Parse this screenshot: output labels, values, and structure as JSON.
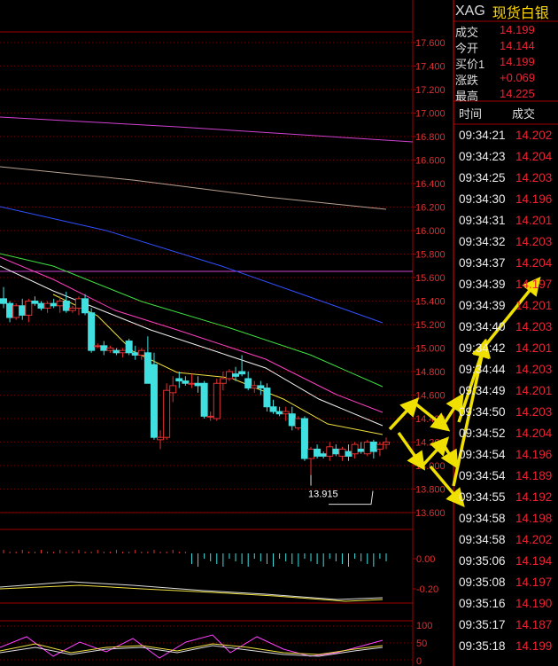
{
  "header": {
    "code": "XAG",
    "name": "现货白银"
  },
  "quote": [
    {
      "label": "成交",
      "value": "14.199"
    },
    {
      "label": "今开",
      "value": "14.144"
    },
    {
      "label": "买价1",
      "value": "14.199"
    },
    {
      "label": "涨跌",
      "value": "+0.069"
    },
    {
      "label": "最高",
      "value": "14.225"
    }
  ],
  "ticks_header": {
    "time": "时间",
    "price": "成交"
  },
  "ticks": [
    {
      "time": "09:34:21",
      "price": "14.202"
    },
    {
      "time": "09:34:23",
      "price": "14.204"
    },
    {
      "time": "09:34:25",
      "price": "14.203"
    },
    {
      "time": "09:34:30",
      "price": "14.196"
    },
    {
      "time": "09:34:31",
      "price": "14.201"
    },
    {
      "time": "09:34:32",
      "price": "14.203"
    },
    {
      "time": "09:34:37",
      "price": "14.204"
    },
    {
      "time": "09:34:39",
      "price": "14.197"
    },
    {
      "time": "09:34:39",
      "price": "14.201"
    },
    {
      "time": "09:34:40",
      "price": "14.203"
    },
    {
      "time": "09:34:42",
      "price": "14.201"
    },
    {
      "time": "09:34:44",
      "price": "14.203"
    },
    {
      "time": "09:34:49",
      "price": "14.201"
    },
    {
      "time": "09:34:50",
      "price": "14.203"
    },
    {
      "time": "09:34:52",
      "price": "14.204"
    },
    {
      "time": "09:34:54",
      "price": "14.196"
    },
    {
      "time": "09:34:54",
      "price": "14.189"
    },
    {
      "time": "09:34:55",
      "price": "14.192"
    },
    {
      "time": "09:34:58",
      "price": "14.198"
    },
    {
      "time": "09:34:58",
      "price": "14.202"
    },
    {
      "time": "09:35:06",
      "price": "14.194"
    },
    {
      "time": "09:35:08",
      "price": "14.197"
    },
    {
      "time": "09:35:16",
      "price": "14.190"
    },
    {
      "time": "09:35:17",
      "price": "14.187"
    },
    {
      "time": "09:35:18",
      "price": "14.199"
    }
  ],
  "colors": {
    "up": "#e23030",
    "down": "#40e0e0",
    "grid": "#7a0000",
    "axis_text": "#e23030",
    "arrow": "#f0e000"
  },
  "chart_data": [
    {
      "type": "candlestick",
      "title": "",
      "ylim": [
        13.6,
        17.7
      ],
      "y_ticks": [
        "17.600",
        "17.400",
        "17.200",
        "17.000",
        "16.800",
        "16.600",
        "16.400",
        "16.200",
        "16.000",
        "15.800",
        "15.600",
        "15.400",
        "15.200",
        "15.000",
        "14.800",
        "14.600",
        "14.400",
        "14.200",
        "14.000",
        "13.800",
        "13.600"
      ],
      "low_label": "13.915",
      "candles": [
        [
          15.42,
          15.52,
          15.34,
          15.38
        ],
        [
          15.38,
          15.4,
          15.22,
          15.26
        ],
        [
          15.26,
          15.38,
          15.24,
          15.36
        ],
        [
          15.36,
          15.42,
          15.24,
          15.28
        ],
        [
          15.28,
          15.42,
          15.22,
          15.4
        ],
        [
          15.4,
          15.44,
          15.36,
          15.38
        ],
        [
          15.38,
          15.4,
          15.32,
          15.34
        ],
        [
          15.34,
          15.4,
          15.3,
          15.38
        ],
        [
          15.38,
          15.42,
          15.34,
          15.36
        ],
        [
          15.36,
          15.44,
          15.3,
          15.4
        ],
        [
          15.4,
          15.48,
          15.3,
          15.32
        ],
        [
          15.32,
          15.36,
          15.3,
          15.34
        ],
        [
          15.34,
          15.44,
          15.28,
          15.42
        ],
        [
          15.42,
          15.46,
          15.28,
          15.3
        ],
        [
          15.3,
          15.34,
          14.96,
          14.98
        ],
        [
          15.02,
          15.04,
          15.0,
          15.02
        ],
        [
          15.02,
          15.06,
          14.94,
          14.98
        ],
        [
          14.98,
          15.02,
          14.96,
          15.0
        ],
        [
          14.98,
          15.0,
          14.94,
          14.96
        ],
        [
          14.96,
          15.0,
          14.92,
          14.98
        ],
        [
          15.06,
          15.08,
          14.94,
          14.96
        ],
        [
          14.96,
          15.02,
          14.9,
          14.94
        ],
        [
          14.94,
          15.0,
          14.9,
          14.98
        ],
        [
          14.96,
          15.1,
          14.74,
          14.7
        ],
        [
          14.86,
          14.96,
          14.22,
          14.24
        ],
        [
          14.22,
          14.3,
          14.14,
          14.24
        ],
        [
          14.24,
          14.7,
          14.22,
          14.64
        ],
        [
          14.62,
          14.76,
          14.54,
          14.68
        ],
        [
          14.74,
          14.8,
          14.66,
          14.72
        ],
        [
          14.72,
          14.76,
          14.68,
          14.7
        ],
        [
          14.7,
          14.78,
          14.66,
          14.7
        ],
        [
          14.7,
          14.76,
          14.62,
          14.68
        ],
        [
          14.7,
          14.72,
          14.4,
          14.42
        ],
        [
          14.42,
          14.46,
          14.38,
          14.42
        ],
        [
          14.4,
          14.74,
          14.38,
          14.7
        ],
        [
          14.7,
          14.8,
          14.64,
          14.74
        ],
        [
          14.74,
          14.82,
          14.72,
          14.8
        ],
        [
          14.78,
          14.84,
          14.72,
          14.76
        ],
        [
          14.8,
          14.94,
          14.76,
          14.78
        ],
        [
          14.74,
          14.8,
          14.64,
          14.66
        ],
        [
          14.66,
          14.72,
          14.62,
          14.68
        ],
        [
          14.68,
          14.72,
          14.6,
          14.66
        ],
        [
          14.66,
          14.7,
          14.46,
          14.5
        ],
        [
          14.5,
          14.56,
          14.44,
          14.46
        ],
        [
          14.46,
          14.5,
          14.42,
          14.44
        ],
        [
          14.44,
          14.5,
          14.38,
          14.46
        ],
        [
          14.44,
          14.5,
          14.3,
          14.34
        ],
        [
          14.32,
          14.42,
          14.3,
          14.4
        ],
        [
          14.4,
          14.42,
          14.04,
          14.06
        ],
        [
          14.06,
          14.16,
          13.92,
          14.14
        ],
        [
          14.14,
          14.18,
          14.06,
          14.08
        ],
        [
          14.1,
          14.12,
          14.06,
          14.08
        ],
        [
          14.08,
          14.2,
          14.04,
          14.16
        ],
        [
          14.14,
          14.18,
          14.08,
          14.1
        ],
        [
          14.08,
          14.16,
          14.04,
          14.14
        ],
        [
          14.12,
          14.18,
          14.04,
          14.08
        ],
        [
          14.1,
          14.2,
          14.06,
          14.18
        ],
        [
          14.14,
          14.2,
          14.1,
          14.12
        ],
        [
          14.1,
          14.22,
          14.08,
          14.2
        ],
        [
          14.2,
          14.22,
          14.06,
          14.12
        ],
        [
          14.14,
          14.2,
          14.08,
          14.18
        ],
        [
          14.18,
          14.24,
          14.14,
          14.2
        ]
      ]
    },
    {
      "type": "bar",
      "title": "",
      "ylim": [
        -0.3,
        0.1
      ],
      "y_ticks": [
        "0.00",
        "-0.20"
      ]
    },
    {
      "type": "line",
      "title": "",
      "ylim": [
        0,
        100
      ],
      "y_ticks": [
        "100",
        "50",
        "0"
      ]
    }
  ]
}
